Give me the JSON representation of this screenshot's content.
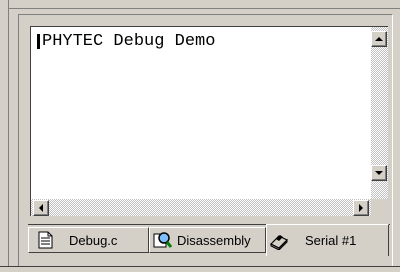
{
  "editor": {
    "content_line": "PHYTEC Debug Demo"
  },
  "tabs": [
    {
      "label": "Debug.c",
      "icon": "document-icon",
      "active": false
    },
    {
      "label": "Disassembly",
      "icon": "disassembly-magnifier-icon",
      "active": false
    },
    {
      "label": "Serial #1",
      "icon": "serial-terminal-icon",
      "active": true
    }
  ]
}
